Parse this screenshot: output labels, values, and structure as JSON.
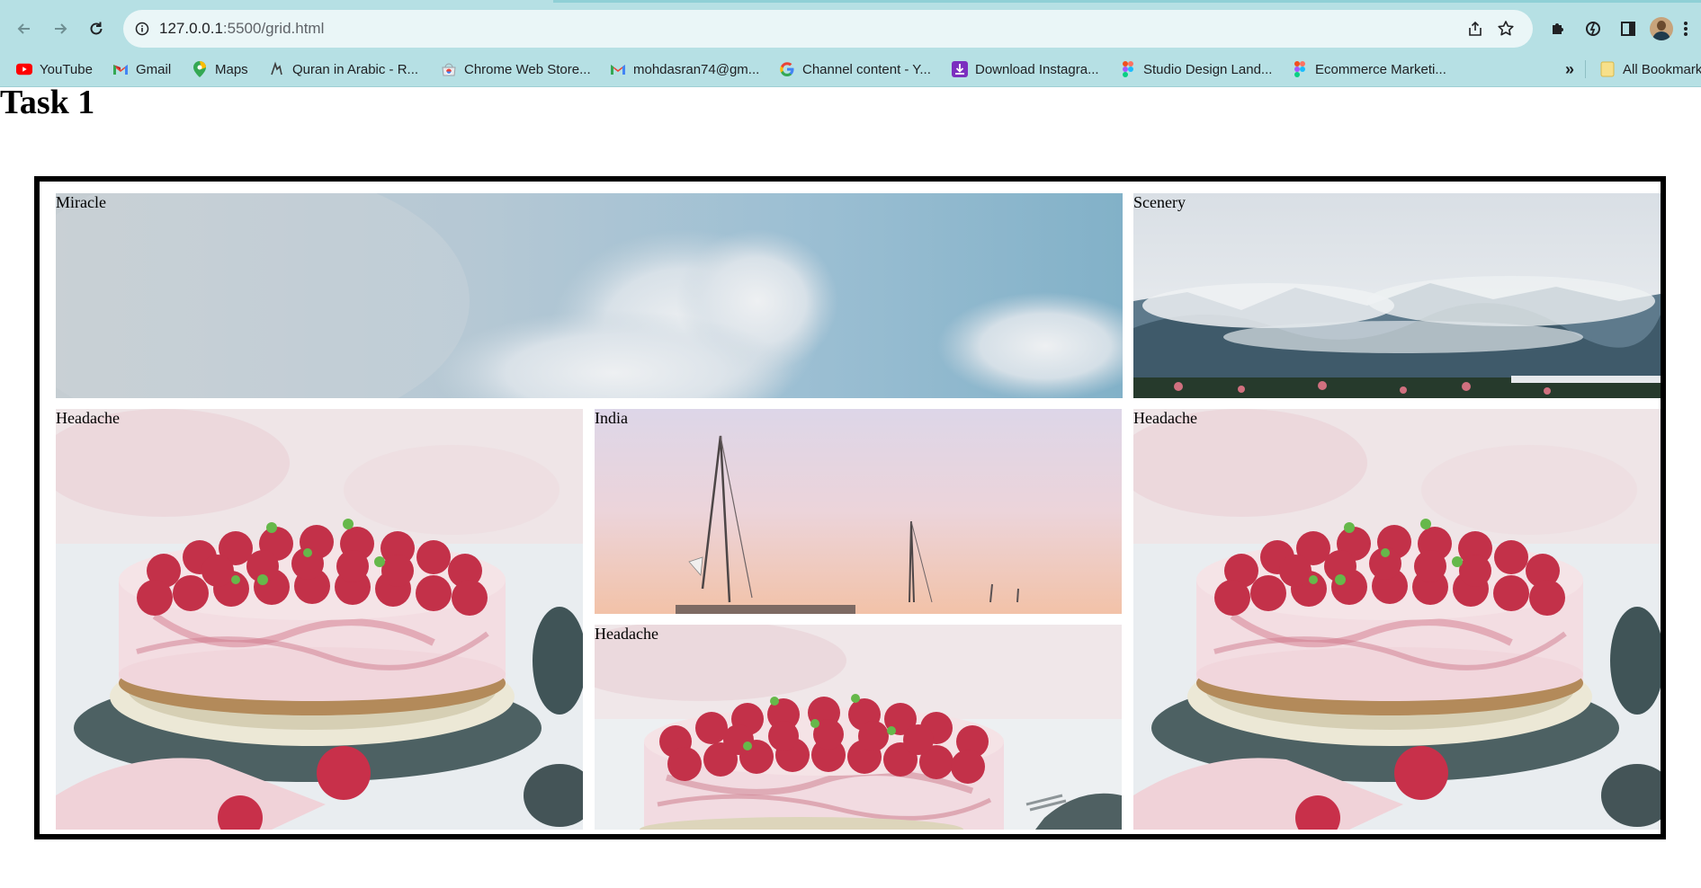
{
  "browser": {
    "url_host": "127.0.0.1",
    "url_path": ":5500/grid.html",
    "bookmarks": [
      {
        "label": "YouTube",
        "icon": "youtube-icon"
      },
      {
        "label": "Gmail",
        "icon": "gmail-icon"
      },
      {
        "label": "Maps",
        "icon": "maps-icon"
      },
      {
        "label": "Quran in Arabic - R...",
        "icon": "quran-icon"
      },
      {
        "label": "Chrome Web Store...",
        "icon": "chrome-web-store-icon"
      },
      {
        "label": "mohdasran74@gm...",
        "icon": "gmail-icon"
      },
      {
        "label": "Channel content - Y...",
        "icon": "google-icon"
      },
      {
        "label": "Download Instagra...",
        "icon": "download-icon"
      },
      {
        "label": "Studio Design Land...",
        "icon": "figma-icon"
      },
      {
        "label": "Ecommerce Marketi...",
        "icon": "figma-icon"
      }
    ],
    "overflow_label": "»",
    "all_bookmarks_label": "All Bookmarks"
  },
  "page": {
    "heading": "Task 1",
    "cells": {
      "miracle": "Miracle",
      "scenery": "Scenery",
      "headache_left": "Headache",
      "india": "India",
      "headache_mid": "Headache",
      "headache_right": "Headache"
    }
  },
  "colors": {
    "chrome_bg": "#b6e0e4",
    "omnibox_bg": "#eaf6f7",
    "grid_border": "#000000",
    "sky": "#8fb7cc",
    "cake_cream": "#f3d9de",
    "raspberry": "#c8344f"
  }
}
